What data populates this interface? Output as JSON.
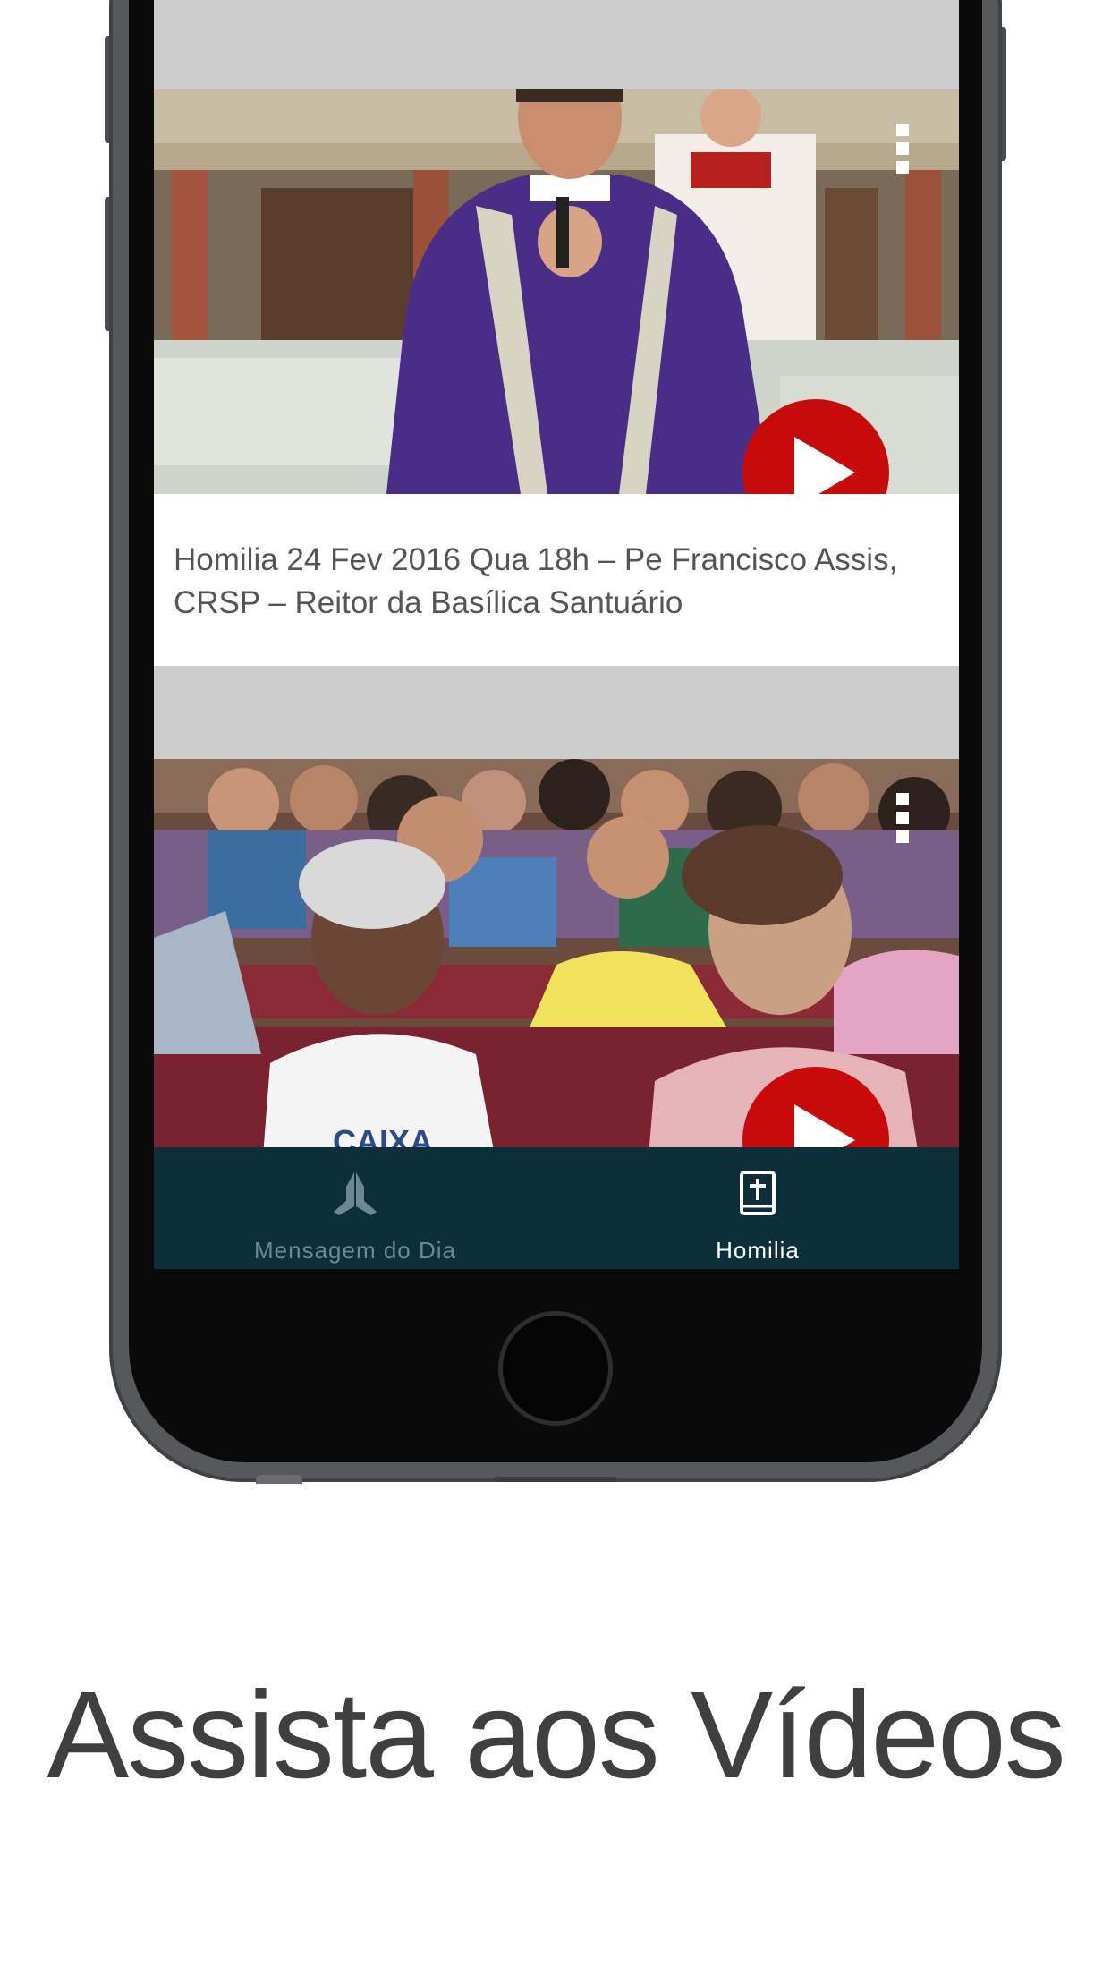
{
  "videos": [
    {
      "title": "Homilia 24 Fev 2016 Qua 18h – Pe  Francisco Assis, CRSP – Reitor da Basílica Santuário",
      "thumbnail_icon": "priest-preaching-photo",
      "play_icon": "play-icon",
      "menu_icon": "kebab-menu-icon"
    },
    {
      "title": "",
      "thumbnail_icon": "congregation-photo",
      "play_icon": "play-icon",
      "menu_icon": "kebab-menu-icon"
    }
  ],
  "tabbar": {
    "tabs": [
      {
        "label": "Mensagem do Dia",
        "icon": "praying-hands-icon",
        "active": false
      },
      {
        "label": "Homilia",
        "icon": "bible-cross-icon",
        "active": true
      }
    ]
  },
  "caption": "Assista aos Vídeos",
  "colors": {
    "tabbar_bg": "#0d2f3a",
    "play_red": "#c80a0a",
    "list_bg": "#cccccc",
    "tab_inactive": "#6d8892",
    "tab_active": "#ffffff"
  }
}
